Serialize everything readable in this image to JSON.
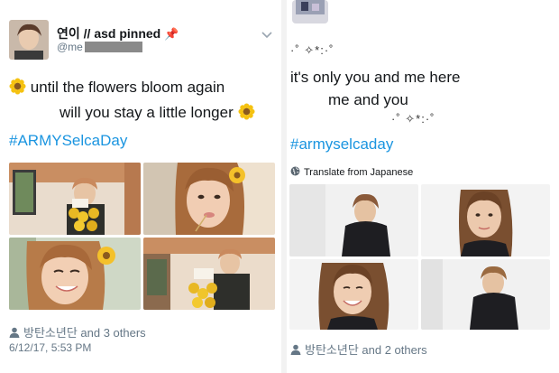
{
  "left_tweet": {
    "display_name": "연이 // asd pinned",
    "handle": "@me",
    "line1": "until the flowers bloom again",
    "line2": "will you stay a little longer",
    "hashtag": "#ARMYSelcaDay",
    "tagged": "방탄소년단 and 3 others",
    "timestamp": "6/12/17, 5:53 PM",
    "icons": [
      "pin-icon",
      "chevron-down-icon",
      "sunflower-icon",
      "person-icon"
    ]
  },
  "right_tweet": {
    "sparkle_top": "·˚ ✧*:·˚",
    "line1": "it's only you and me here",
    "line2": "me and you",
    "sparkle_bottom": "·˚ ✧*:·˚",
    "hashtag": "#armyselcaday",
    "translate": "Translate from Japanese",
    "tagged": "방탄소년단 and 2 others",
    "icons": [
      "globe-icon",
      "person-icon"
    ]
  },
  "colors": {
    "link_blue": "#1b95e0",
    "muted_gray": "#657786",
    "text_dark": "#14171a"
  }
}
